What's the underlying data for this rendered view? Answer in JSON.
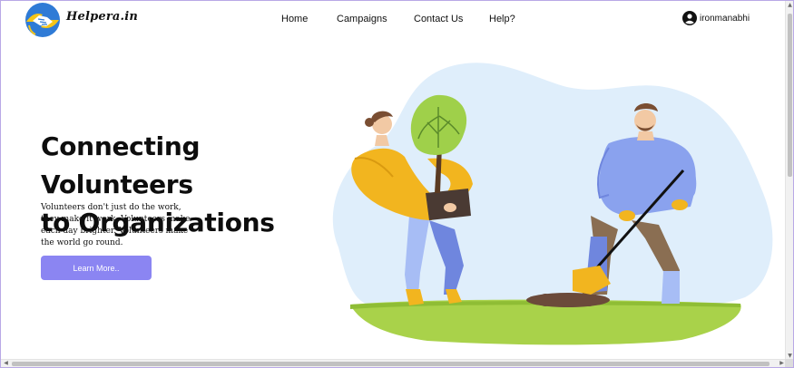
{
  "brand": {
    "name": "Helpera.in",
    "logo_icon": "handshake-icon",
    "logo_colors": {
      "circle": "#2f7bd6",
      "accent": "#f5c518"
    }
  },
  "nav": {
    "items": [
      {
        "label": "Home"
      },
      {
        "label": "Campaigns"
      },
      {
        "label": "Contact Us"
      },
      {
        "label": "Help?"
      }
    ]
  },
  "user": {
    "icon": "user-circle-icon",
    "username": "ironmanabhi"
  },
  "hero": {
    "title_line1": "Connecting Volunteers",
    "title_line2": "to Organizations",
    "description": "Volunteers don't just do the work, they make it work. Volunteers make each day brighter. Volunteers make the world go round.",
    "cta_label": "Learn More..",
    "cta_color": "#8b85f2"
  },
  "illustration": {
    "subject": "two volunteers planting a tree",
    "colors": {
      "blob": "#dfeefb",
      "grass": "#a9d24a",
      "shirt_yellow": "#f2b51f",
      "shirt_blue": "#8aa2ee",
      "pants_blue": "#6f86de"
    }
  },
  "scrollbars": {
    "vertical": "visible",
    "horizontal": "visible"
  }
}
